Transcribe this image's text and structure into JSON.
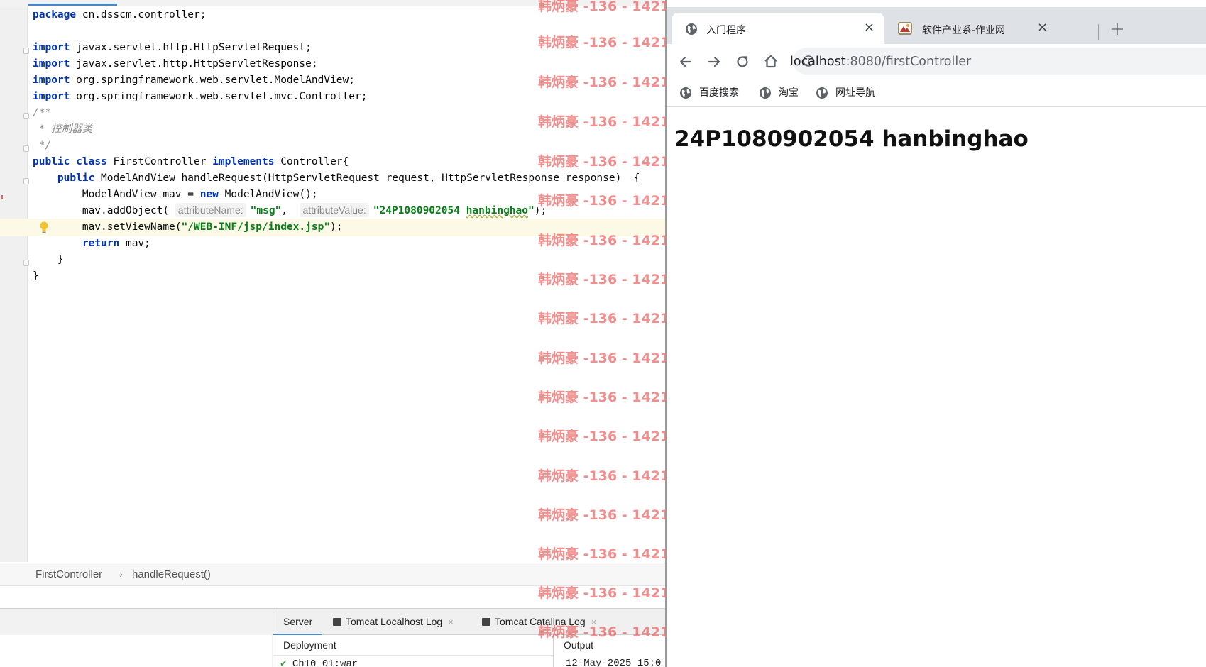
{
  "ide": {
    "code": {
      "l1": {
        "kw": "package",
        "rest": " cn.dsscm.controller;"
      },
      "l3": {
        "kw": "import",
        "rest": " javax.servlet.http.HttpServletRequest;"
      },
      "l4": {
        "kw": "import",
        "rest": " javax.servlet.http.HttpServletResponse;"
      },
      "l5": {
        "kw": "import",
        "rest": " org.springframework.web.servlet.ModelAndView;"
      },
      "l6": {
        "kw": "import",
        "rest": " org.springframework.web.servlet.mvc.Controller;"
      },
      "l7": "/**",
      "l8": " * 控制器类",
      "l9": " */",
      "l10": {
        "kw1": "public",
        "kw2": "class",
        "name": " FirstController ",
        "kw3": "implements",
        "rest": " Controller{"
      },
      "l11": {
        "indent": "    ",
        "kw": "public",
        "rest": " ModelAndView handleRequest(HttpServletRequest request, HttpServletResponse response)  {"
      },
      "l12": {
        "indent": "        ",
        "pre": "ModelAndView mav = ",
        "kw": "new",
        "rest": " ModelAndView();"
      },
      "l13": {
        "indent": "        ",
        "pre": "mav.addObject( ",
        "hint1": "attributeName:",
        "str1": "\"msg\"",
        "mid": ",  ",
        "hint2": "attributeValue:",
        "str2a": "\"24P1080902054 ",
        "str2b": "hanbinghao",
        "str2c": "\"",
        "rest": ");"
      },
      "l14": {
        "indent": "        ",
        "pre": "mav.setViewName(",
        "str": "\"/WEB-INF/jsp/index.jsp\"",
        "rest": ");"
      },
      "l15": {
        "indent": "        ",
        "kw": "return",
        "rest": " mav;"
      },
      "l16": "    }",
      "l17": "}"
    },
    "breadcrumb": {
      "class": "FirstController",
      "sep": "›",
      "method": "handleRequest()"
    },
    "bottom": {
      "tabs": {
        "server": "Server",
        "localhost_log": "Tomcat Localhost Log",
        "catalina_log": "Tomcat Catalina Log",
        "close": "×"
      },
      "deployment_header": "Deployment",
      "deployment_item": "Ch10_01:war",
      "output_header": "Output",
      "output_line": "12-May-2025 15:0"
    }
  },
  "watermark": "韩炳豪 -136 - 1421",
  "browser": {
    "tabs": [
      {
        "title": "入门程序",
        "close": "×"
      },
      {
        "title": "软件产业系-作业网",
        "close": "×"
      }
    ],
    "new_tab": "+",
    "url": {
      "host": "localhost",
      "path": ":8080/firstController"
    },
    "bookmarks": [
      "百度搜索",
      "淘宝",
      "网址导航"
    ],
    "page_heading": "24P1080902054 hanbinghao"
  }
}
